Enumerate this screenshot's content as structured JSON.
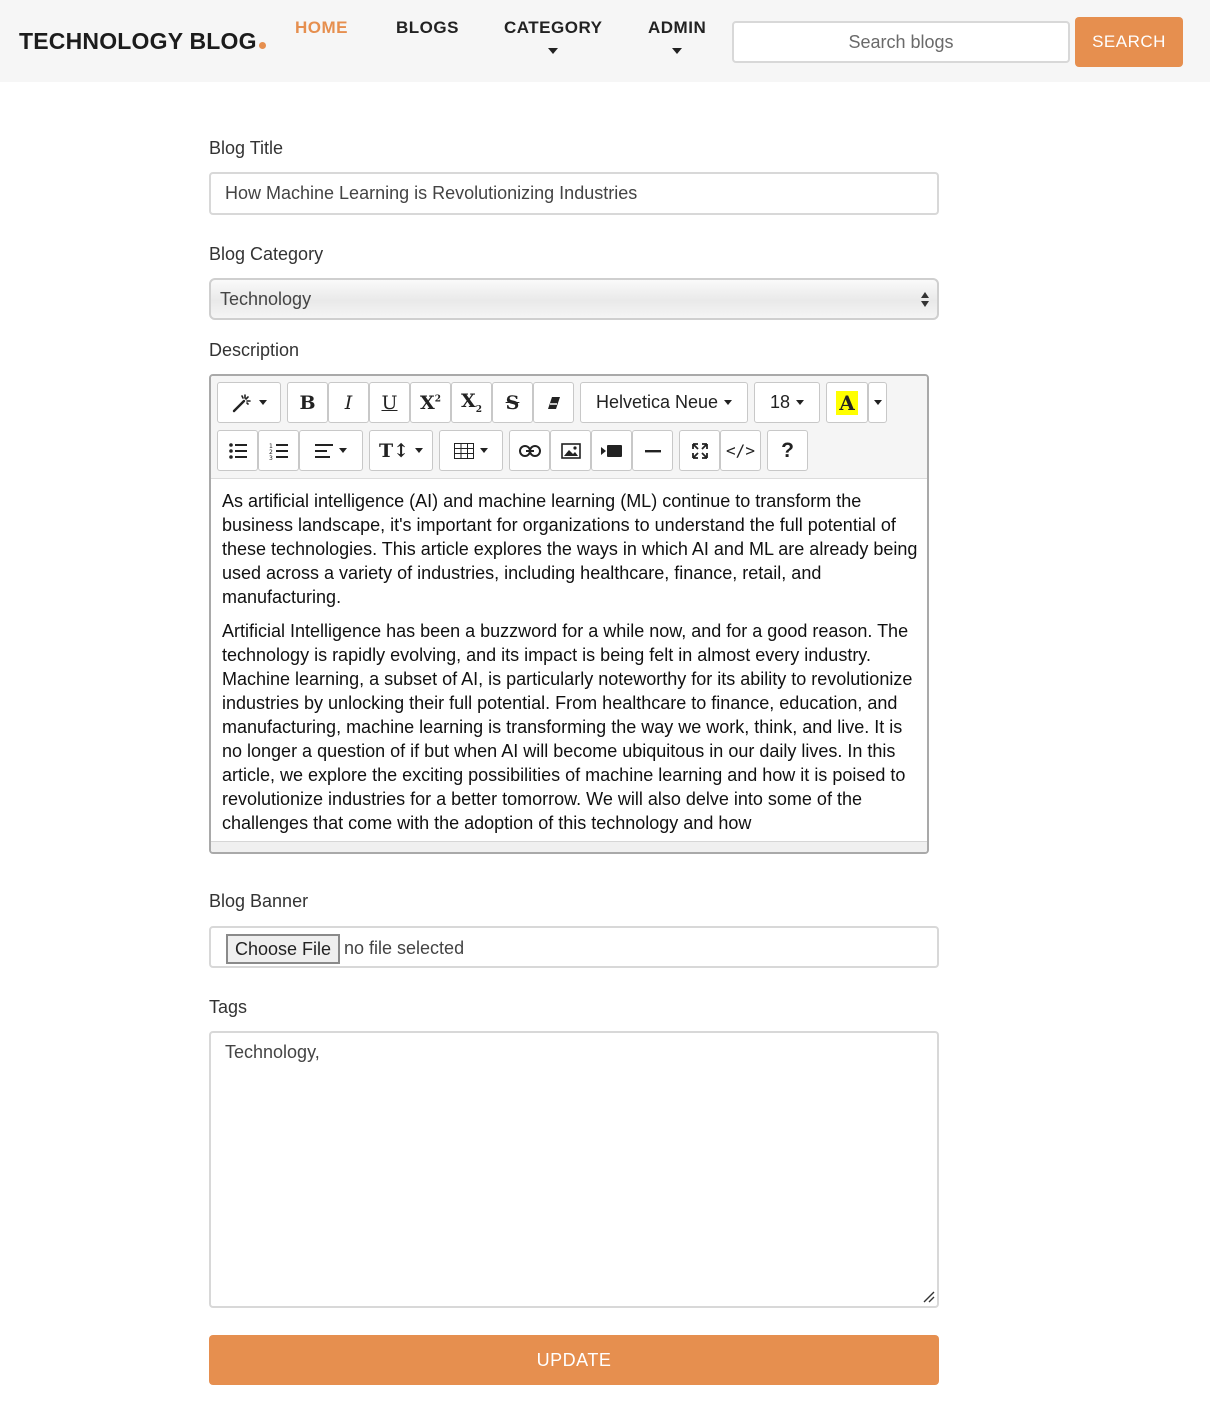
{
  "header": {
    "brand": "TECHNOLOGY BLOG",
    "nav": {
      "home": "HOME",
      "blogs": "BLOGS",
      "category": "CATEGORY",
      "admin": "ADMIN"
    },
    "search": {
      "placeholder": "Search blogs",
      "button": "SEARCH"
    }
  },
  "form": {
    "title_label": "Blog Title",
    "title_value": "How Machine Learning is Revolutionizing Industries",
    "category_label": "Blog Category",
    "category_value": "Technology",
    "description_label": "Description",
    "banner_label": "Blog Banner",
    "file_button": "Choose File",
    "file_status": "no file selected",
    "tags_label": "Tags",
    "tags_value": "Technology,",
    "submit": "UPDATE"
  },
  "editor": {
    "toolbar": {
      "font_name": "Helvetica Neue",
      "font_size": "18",
      "buttons": [
        "magic",
        "bold",
        "italic",
        "underline",
        "superscript",
        "subscript",
        "strikethrough",
        "clear-format",
        "font-name",
        "font-size",
        "color",
        "unordered-list",
        "ordered-list",
        "paragraph-align",
        "line-height",
        "table",
        "link",
        "picture",
        "video",
        "horizontal-rule",
        "fullscreen",
        "code-view",
        "help"
      ]
    },
    "paragraphs": [
      "As artificial intelligence (AI) and machine learning (ML) continue to transform the business landscape, it's important for organizations to understand the full potential of these technologies. This article explores the ways in which AI and ML are already being used across a variety of industries, including healthcare, finance, retail, and manufacturing.",
      "Artificial Intelligence has been a buzzword for a while now, and for a good reason. The technology is rapidly evolving, and its impact is being felt in almost every industry. Machine learning, a subset of AI, is particularly noteworthy for its ability to revolutionize industries by unlocking their full potential. From healthcare to finance, education, and manufacturing, machine learning is transforming the way we work, think, and live. It is no longer a question of if but when AI will become ubiquitous in our daily lives. In this article, we explore the exciting possibilities of machine learning and how it is poised to revolutionize industries for a better tomorrow. We will also delve into some of the challenges that come with the adoption of this technology and how"
    ]
  },
  "colors": {
    "accent": "#e68f4f",
    "header_bg": "#f6f6f6",
    "highlight": "#ffff00"
  }
}
